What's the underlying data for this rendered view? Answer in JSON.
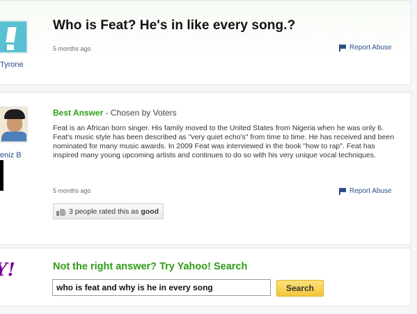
{
  "question": {
    "title": "Who is Feat? He's in like every song.?",
    "asker": "Tyrone",
    "time": "5 months ago",
    "report": "Report Abuse"
  },
  "answer": {
    "user": "eniz B",
    "best_label": "Best Answer",
    "chosen_by": " - Chosen by Voters",
    "body": "Feat is an African born singer. His family moved to the United States from Nigeria when he was only 6. Feat's music style has been described as \"very quiet echo's\" from time to time. He has received and been nominated for many music awards. In 2009 Feat was interviewed in the book \"how to rap\". Feat has inspired many young upcoming artists and continues to do so with his very unique vocal techniques.",
    "time": "5 months ago",
    "report": "Report Abuse",
    "rating_prefix": "3 people rated this as ",
    "rating_value": "good"
  },
  "search": {
    "logo": "Y!",
    "prompt": "Not the right answer? Try Yahoo! Search",
    "query": "who is feat and why is he in every song",
    "button": "Search"
  },
  "colors": {
    "best_answer_green": "#2e9c17",
    "link_blue": "#2a4f8a",
    "yahoo_purple": "#7b0099",
    "search_button_yellow": "#f2c63a"
  }
}
